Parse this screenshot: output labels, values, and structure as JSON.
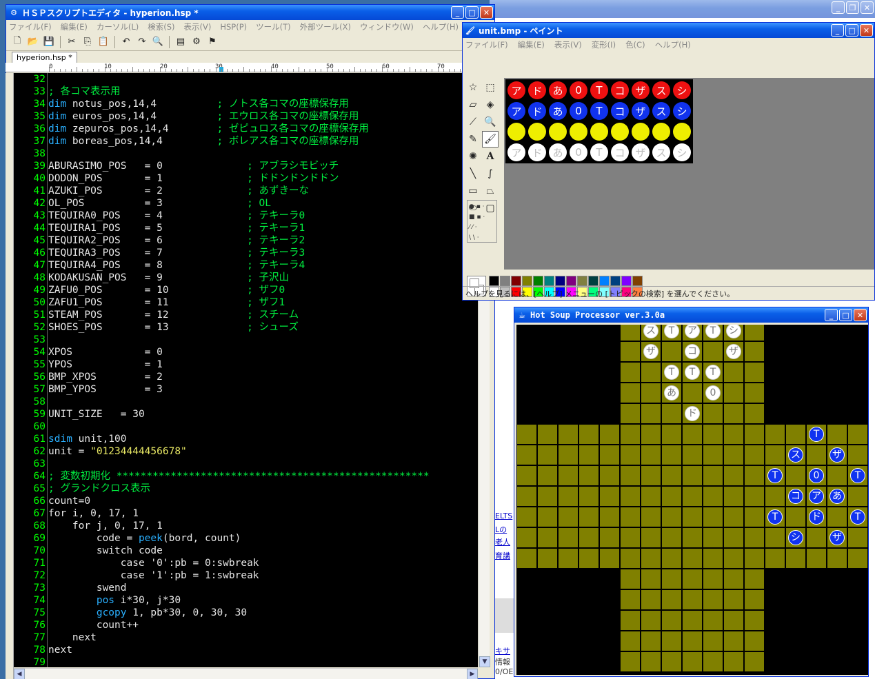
{
  "editor": {
    "title": "ＨＳＰスクリプトエディタ - hyperion.hsp *",
    "menu": [
      "ファイル(F)",
      "編集(E)",
      "カーソル(L)",
      "検索(S)",
      "表示(V)",
      "HSP(P)",
      "ツール(T)",
      "外部ツール(X)",
      "ウィンドウ(W)",
      "ヘルプ(H)"
    ],
    "tab": "hyperion.hsp *",
    "ruler": [
      "0",
      "10",
      "20",
      "30",
      "40",
      "50",
      "60",
      "70"
    ],
    "toolbar_icons": [
      "new-icon",
      "open-icon",
      "save-icon",
      "cut-icon",
      "copy-icon",
      "paste-icon",
      "undo-icon",
      "redo-icon",
      "find-icon",
      "run-icon",
      "build-icon",
      "debug-icon"
    ],
    "lines": [
      {
        "n": "32",
        "parts": []
      },
      {
        "n": "33",
        "parts": [
          [
            "c-cm",
            "; 各コマ表示用"
          ]
        ]
      },
      {
        "n": "34",
        "parts": [
          [
            "c-kw",
            "dim"
          ],
          [
            "c-def",
            " notus_pos,14,4          "
          ],
          [
            "c-cm",
            "; ノトス各コマの座標保存用"
          ]
        ]
      },
      {
        "n": "35",
        "parts": [
          [
            "c-kw",
            "dim"
          ],
          [
            "c-def",
            " euros_pos,14,4          "
          ],
          [
            "c-cm",
            "; エウロス各コマの座標保存用"
          ]
        ]
      },
      {
        "n": "36",
        "parts": [
          [
            "c-kw",
            "dim"
          ],
          [
            "c-def",
            " zepuros_pos,14,4        "
          ],
          [
            "c-cm",
            "; ゼピュロス各コマの座標保存用"
          ]
        ]
      },
      {
        "n": "37",
        "parts": [
          [
            "c-kw",
            "dim"
          ],
          [
            "c-def",
            " boreas_pos,14,4         "
          ],
          [
            "c-cm",
            "; ボレアス各コマの座標保存用"
          ]
        ]
      },
      {
        "n": "38",
        "parts": []
      },
      {
        "n": "39",
        "parts": [
          [
            "c-def",
            "ABURASIMO_POS   = 0              "
          ],
          [
            "c-cm",
            "; アブラシモビッチ"
          ]
        ]
      },
      {
        "n": "40",
        "parts": [
          [
            "c-def",
            "DODON_POS       = 1              "
          ],
          [
            "c-cm",
            "; ドドンドンドドン"
          ]
        ]
      },
      {
        "n": "41",
        "parts": [
          [
            "c-def",
            "AZUKI_POS       = 2              "
          ],
          [
            "c-cm",
            "; あずきーな"
          ]
        ]
      },
      {
        "n": "42",
        "parts": [
          [
            "c-def",
            "OL_POS          = 3              "
          ],
          [
            "c-cm",
            "; OL"
          ]
        ]
      },
      {
        "n": "43",
        "parts": [
          [
            "c-def",
            "TEQUIRA0_POS    = 4              "
          ],
          [
            "c-cm",
            "; テキーラ0"
          ]
        ]
      },
      {
        "n": "44",
        "parts": [
          [
            "c-def",
            "TEQUIRA1_POS    = 5              "
          ],
          [
            "c-cm",
            "; テキーラ1"
          ]
        ]
      },
      {
        "n": "45",
        "parts": [
          [
            "c-def",
            "TEQUIRA2_POS    = 6              "
          ],
          [
            "c-cm",
            "; テキーラ2"
          ]
        ]
      },
      {
        "n": "46",
        "parts": [
          [
            "c-def",
            "TEQUIRA3_POS    = 7              "
          ],
          [
            "c-cm",
            "; テキーラ3"
          ]
        ]
      },
      {
        "n": "47",
        "parts": [
          [
            "c-def",
            "TEQUIRA4_POS    = 8              "
          ],
          [
            "c-cm",
            "; テキーラ4"
          ]
        ]
      },
      {
        "n": "48",
        "parts": [
          [
            "c-def",
            "KODAKUSAN_POS   = 9              "
          ],
          [
            "c-cm",
            "; 子沢山"
          ]
        ]
      },
      {
        "n": "49",
        "parts": [
          [
            "c-def",
            "ZAFU0_POS       = 10             "
          ],
          [
            "c-cm",
            "; ザフ0"
          ]
        ]
      },
      {
        "n": "50",
        "parts": [
          [
            "c-def",
            "ZAFU1_POS       = 11             "
          ],
          [
            "c-cm",
            "; ザフ1"
          ]
        ]
      },
      {
        "n": "51",
        "parts": [
          [
            "c-def",
            "STEAM_POS       = 12             "
          ],
          [
            "c-cm",
            "; スチーム"
          ]
        ]
      },
      {
        "n": "52",
        "parts": [
          [
            "c-def",
            "SHOES_POS       = 13             "
          ],
          [
            "c-cm",
            "; シューズ"
          ]
        ]
      },
      {
        "n": "53",
        "parts": []
      },
      {
        "n": "54",
        "parts": [
          [
            "c-def",
            "XPOS            = 0"
          ]
        ]
      },
      {
        "n": "55",
        "parts": [
          [
            "c-def",
            "YPOS            = 1"
          ]
        ]
      },
      {
        "n": "56",
        "parts": [
          [
            "c-def",
            "BMP_XPOS        = 2"
          ]
        ]
      },
      {
        "n": "57",
        "parts": [
          [
            "c-def",
            "BMP_YPOS        = 3"
          ]
        ]
      },
      {
        "n": "58",
        "parts": []
      },
      {
        "n": "59",
        "parts": [
          [
            "c-def",
            "UNIT_SIZE   = 30"
          ]
        ]
      },
      {
        "n": "60",
        "parts": []
      },
      {
        "n": "61",
        "parts": [
          [
            "c-kw",
            "sdim"
          ],
          [
            "c-def",
            " unit,100"
          ]
        ]
      },
      {
        "n": "62",
        "parts": [
          [
            "c-def",
            "unit = "
          ],
          [
            "c-st",
            "\"01234444456678\""
          ]
        ]
      },
      {
        "n": "63",
        "parts": []
      },
      {
        "n": "64",
        "parts": [
          [
            "c-cm",
            "; 変数初期化 ****************************************************"
          ]
        ]
      },
      {
        "n": "65",
        "parts": [
          [
            "c-cm",
            "; グランドクロス表示"
          ]
        ]
      },
      {
        "n": "66",
        "parts": [
          [
            "c-def",
            "count=0"
          ]
        ]
      },
      {
        "n": "67",
        "parts": [
          [
            "c-def",
            "for i, 0, 17, 1"
          ]
        ]
      },
      {
        "n": "68",
        "parts": [
          [
            "c-def",
            "    for j, 0, 17, 1"
          ]
        ]
      },
      {
        "n": "69",
        "parts": [
          [
            "c-def",
            "        code = "
          ],
          [
            "c-kw",
            "peek"
          ],
          [
            "c-def",
            "(bord, count)"
          ]
        ]
      },
      {
        "n": "70",
        "parts": [
          [
            "c-def",
            "        switch code"
          ]
        ]
      },
      {
        "n": "71",
        "parts": [
          [
            "c-def",
            "            case '0':pb = 0:swbreak"
          ]
        ]
      },
      {
        "n": "72",
        "parts": [
          [
            "c-def",
            "            case '1':pb = 1:swbreak"
          ]
        ]
      },
      {
        "n": "73",
        "parts": [
          [
            "c-def",
            "        swend"
          ]
        ]
      },
      {
        "n": "74",
        "parts": [
          [
            "c-kw",
            "        pos"
          ],
          [
            "c-def",
            " i*30, j*30"
          ]
        ]
      },
      {
        "n": "75",
        "parts": [
          [
            "c-kw",
            "        gcopy"
          ],
          [
            "c-def",
            " 1, pb*30, 0, 30, 30"
          ]
        ]
      },
      {
        "n": "76",
        "parts": [
          [
            "c-def",
            "        count++"
          ]
        ]
      },
      {
        "n": "77",
        "parts": [
          [
            "c-def",
            "    next"
          ]
        ]
      },
      {
        "n": "78",
        "parts": [
          [
            "c-def",
            "next"
          ]
        ]
      },
      {
        "n": "79",
        "parts": []
      }
    ]
  },
  "paint": {
    "title": "unit.bmp - ペイント",
    "menu": [
      "ファイル(F)",
      "編集(E)",
      "表示(V)",
      "変形(I)",
      "色(C)",
      "ヘルプ(H)"
    ],
    "units": [
      "ア",
      "ド",
      "あ",
      "0",
      "T",
      "コ",
      "ザ",
      "ス",
      "シ"
    ],
    "row_colors": [
      "#ee1111",
      "#1133ee",
      "#eeee00",
      "#ffffff"
    ],
    "row_text": [
      "#ffffff",
      "#ffffff",
      "#eeee00",
      "#bbbbbb"
    ],
    "tools": [
      "free-select-icon",
      "rect-select-icon",
      "eraser-icon",
      "fill-icon",
      "eyedropper-icon",
      "magnifier-icon",
      "pencil-icon",
      "brush-icon",
      "airbrush-icon",
      "text-icon",
      "line-icon",
      "curve-icon",
      "rectangle-icon",
      "polygon-icon",
      "ellipse-icon",
      "rounded-rect-icon"
    ],
    "palette_top": [
      "#000000",
      "#808080",
      "#800000",
      "#808000",
      "#008000",
      "#008080",
      "#000080",
      "#800080",
      "#808040",
      "#004040",
      "#0080ff",
      "#004080",
      "#8000ff",
      "#804000"
    ],
    "palette_bottom": [
      "#ffffff",
      "#c0c0c0",
      "#ff0000",
      "#ffff00",
      "#00ff00",
      "#00ffff",
      "#0000ff",
      "#ff00ff",
      "#ffff80",
      "#00ff80",
      "#80ffff",
      "#8080ff",
      "#ff0080",
      "#ff8040"
    ],
    "status": "ヘルプを見るには、[ヘルプ] メニューの [トピックの検索] を選んでください。"
  },
  "hsp": {
    "title": "Hot Soup Processor ver.3.0a",
    "board_color": "#808000",
    "white_pieces": [
      [
        "ス",
        0
      ],
      [
        "T",
        1
      ],
      [
        "ア",
        2
      ],
      [
        "T",
        3
      ],
      [
        "シ",
        4
      ],
      [
        "ザ",
        5
      ],
      [
        "コ",
        6
      ],
      [
        "ザ",
        7
      ],
      [
        "T",
        8
      ],
      [
        "T",
        9
      ],
      [
        "T",
        10
      ],
      [
        "あ",
        11
      ],
      [
        "0",
        12
      ],
      [
        "ド",
        13
      ]
    ],
    "blue_pieces": [
      [
        "T",
        0
      ],
      [
        "ス",
        1
      ],
      [
        "ザ",
        2
      ],
      [
        "T",
        3
      ],
      [
        "0",
        4
      ],
      [
        "T",
        5
      ],
      [
        "コ",
        6
      ],
      [
        "ア",
        7
      ],
      [
        "あ",
        8
      ],
      [
        "T",
        9
      ],
      [
        "ド",
        10
      ],
      [
        "T",
        11
      ],
      [
        "シ",
        12
      ],
      [
        "ザ",
        13
      ]
    ]
  },
  "background": {
    "bg_texts": [
      "ELTS",
      "Lの",
      "老人",
      "育講",
      "キサ",
      "情報",
      "0/OE"
    ]
  }
}
